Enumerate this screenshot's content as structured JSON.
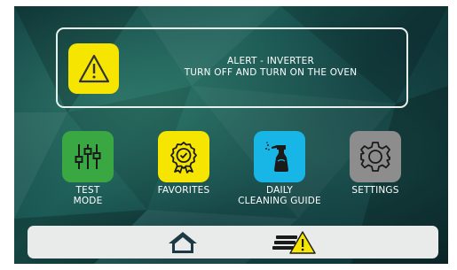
{
  "alert": {
    "line1": "ALERT - INVERTER",
    "line2": "TURN OFF AND TURN ON THE OVEN",
    "icon": "warning-triangle-icon",
    "tile_color": "#f5e500"
  },
  "menu": {
    "items": [
      {
        "label_line1": "TEST",
        "label_line2": "MODE",
        "icon": "sliders-icon",
        "color": "#3aa842"
      },
      {
        "label_line1": "FAVORITES",
        "label_line2": "",
        "icon": "award-badge-icon",
        "color": "#f5e500"
      },
      {
        "label_line1": "DAILY",
        "label_line2": "CLEANING GUIDE",
        "icon": "spray-bottle-icon",
        "color": "#18b6e6"
      },
      {
        "label_line1": "SETTINGS",
        "label_line2": "",
        "icon": "gear-icon",
        "color": "#8d8d8d"
      }
    ]
  },
  "bottom_bar": {
    "home_icon": "home-icon",
    "alerts_icon": "menu-warning-icon",
    "color": "#e9ebea"
  }
}
